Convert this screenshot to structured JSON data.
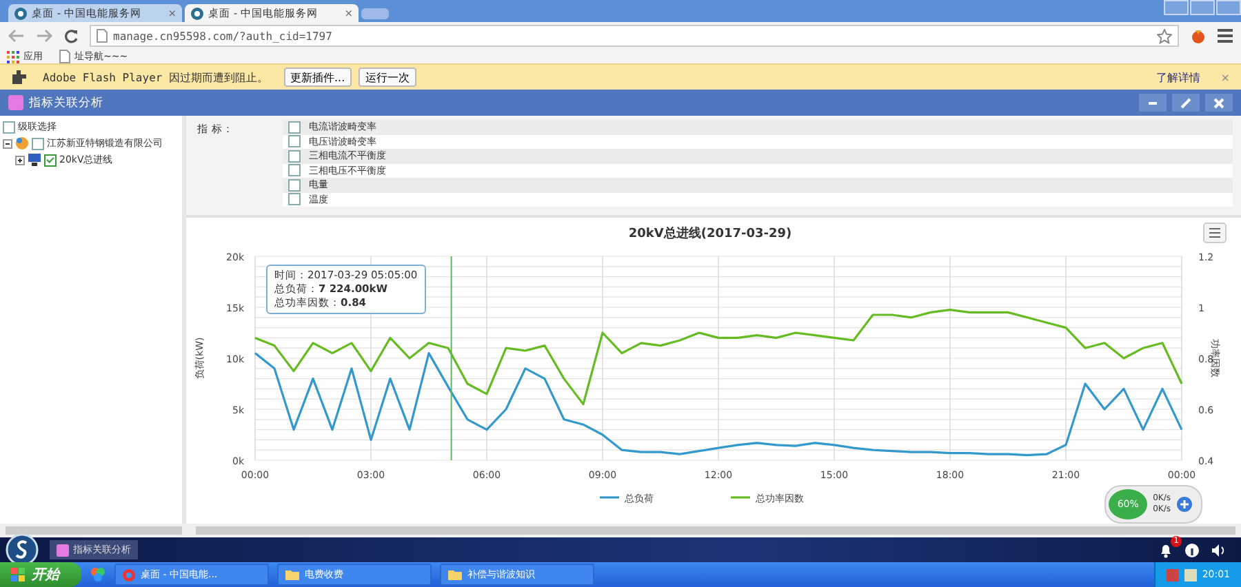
{
  "browser": {
    "tabs": [
      {
        "label": "桌面 - 中国电能服务网",
        "close": "×",
        "selected": false
      },
      {
        "label": "桌面 - 中国电能服务网",
        "close": "×",
        "selected": true
      }
    ],
    "address": "manage.cn95598.com/?auth_cid=1797",
    "bookmarks": [
      {
        "label": "应用",
        "kind": "apps"
      },
      {
        "label": "址导航~~~",
        "kind": "page"
      }
    ],
    "infobar": {
      "message": "Adobe Flash Player 因过期而遭到阻止。",
      "buttons": [
        "更新插件...",
        "运行一次"
      ],
      "link": "了解详情",
      "close": "×"
    }
  },
  "app": {
    "title": "指标关联分析"
  },
  "tree": {
    "select_all": {
      "label": "级联选择",
      "checked": false
    },
    "nodes": [
      {
        "label": "江苏新亚特钢锻造有限公司",
        "checked": false,
        "expanded": true,
        "children": [
          {
            "label": "20kV总进线",
            "checked": true,
            "expanded": false
          }
        ]
      }
    ]
  },
  "indicators": {
    "label": "指 标：",
    "items": [
      {
        "label": "电流谐波畸变率",
        "checked": false
      },
      {
        "label": "电压谐波畸变率",
        "checked": false
      },
      {
        "label": "三相电流不平衡度",
        "checked": false
      },
      {
        "label": "三相电压不平衡度",
        "checked": false
      },
      {
        "label": "电量",
        "checked": false
      },
      {
        "label": "温度",
        "checked": false
      }
    ]
  },
  "chart": {
    "chart_data": {
      "type": "line",
      "title": "20kV总进线(2017-03-29)",
      "ylabel": "负荷(kW)",
      "y2label": "功率因数",
      "x": [
        0,
        0.5,
        1,
        1.5,
        2,
        2.5,
        3,
        3.5,
        4,
        4.5,
        5,
        5.5,
        6,
        6.5,
        7,
        7.5,
        8,
        8.5,
        9,
        9.5,
        10,
        10.5,
        11,
        11.5,
        12,
        12.5,
        13,
        13.5,
        14,
        14.5,
        15,
        15.5,
        16,
        16.5,
        17,
        17.5,
        18,
        18.5,
        19,
        19.5,
        20,
        20.5,
        21,
        21.5,
        22,
        22.5,
        23,
        23.5,
        24
      ],
      "series": [
        {
          "name": "总负荷",
          "color": "#3399cc",
          "values": [
            10500,
            9000,
            3000,
            8000,
            3000,
            9000,
            2000,
            8000,
            3000,
            10500,
            7200,
            4000,
            3000,
            5000,
            9000,
            8000,
            4000,
            3500,
            2500,
            1000,
            800,
            800,
            600,
            900,
            1200,
            1500,
            1700,
            1500,
            1400,
            1700,
            1500,
            1200,
            1000,
            900,
            800,
            800,
            700,
            700,
            600,
            600,
            500,
            600,
            1500,
            7500,
            5000,
            7000,
            3000,
            7000,
            3000
          ]
        },
        {
          "name": "总功率因数",
          "color": "#66bb22",
          "axis": "y2",
          "values": [
            0.88,
            0.85,
            0.75,
            0.86,
            0.82,
            0.86,
            0.75,
            0.88,
            0.8,
            0.86,
            0.84,
            0.7,
            0.66,
            0.84,
            0.83,
            0.85,
            0.72,
            0.62,
            0.9,
            0.82,
            0.86,
            0.85,
            0.87,
            0.9,
            0.88,
            0.88,
            0.89,
            0.88,
            0.9,
            0.89,
            0.88,
            0.87,
            0.97,
            0.97,
            0.96,
            0.98,
            0.99,
            0.98,
            0.98,
            0.98,
            0.96,
            0.94,
            0.92,
            0.84,
            0.86,
            0.8,
            0.84,
            0.86,
            0.7
          ]
        }
      ],
      "grid": true,
      "legend": true,
      "ref_lines": [
        {
          "value": 5.083,
          "axis": "x",
          "color": "#5cb85c"
        }
      ],
      "xlim": [
        0,
        24
      ],
      "ylim": [
        0,
        20000
      ],
      "y2lim": [
        0.4,
        1.2
      ],
      "xticks": [
        {
          "value": 0,
          "label": "00:00"
        },
        {
          "value": 3,
          "label": "03:00"
        },
        {
          "value": 6,
          "label": "06:00"
        },
        {
          "value": 9,
          "label": "09:00"
        },
        {
          "value": 12,
          "label": "12:00"
        },
        {
          "value": 15,
          "label": "15:00"
        },
        {
          "value": 18,
          "label": "18:00"
        },
        {
          "value": 21,
          "label": "21:00"
        },
        {
          "value": 24,
          "label": "00:00"
        }
      ],
      "yticks": [
        {
          "value": 0,
          "label": "0k"
        },
        {
          "value": 5000,
          "label": "5k"
        },
        {
          "value": 10000,
          "label": "10k"
        },
        {
          "value": 15000,
          "label": "15k"
        },
        {
          "value": 20000,
          "label": "20k"
        }
      ],
      "y2ticks": [
        {
          "value": 0.4,
          "label": "0.4"
        },
        {
          "value": 0.6,
          "label": "0.6"
        },
        {
          "value": 0.8,
          "label": "0.8"
        },
        {
          "value": 1,
          "label": "1"
        },
        {
          "value": 1.2,
          "label": "1.2"
        }
      ]
    },
    "tooltip": {
      "lines": [
        "时间：2017-03-29 05:05:00",
        "总负荷：**7 224.00kW**",
        "总功率因数：**0.84**"
      ]
    }
  },
  "app_taskbar": {
    "tab": "指标关联分析"
  },
  "monitor": {
    "percent": "60%",
    "upload": "0K/s",
    "download": "0K/s"
  },
  "taskbar": {
    "start": "开始",
    "items": [
      {
        "label": "桌面 - 中国电能...",
        "kind": "browser"
      },
      {
        "label": "电费收费",
        "kind": "folder"
      },
      {
        "label": "补偿与谐波知识",
        "kind": "folder"
      }
    ],
    "notifications": "1",
    "clock": "20:01"
  }
}
